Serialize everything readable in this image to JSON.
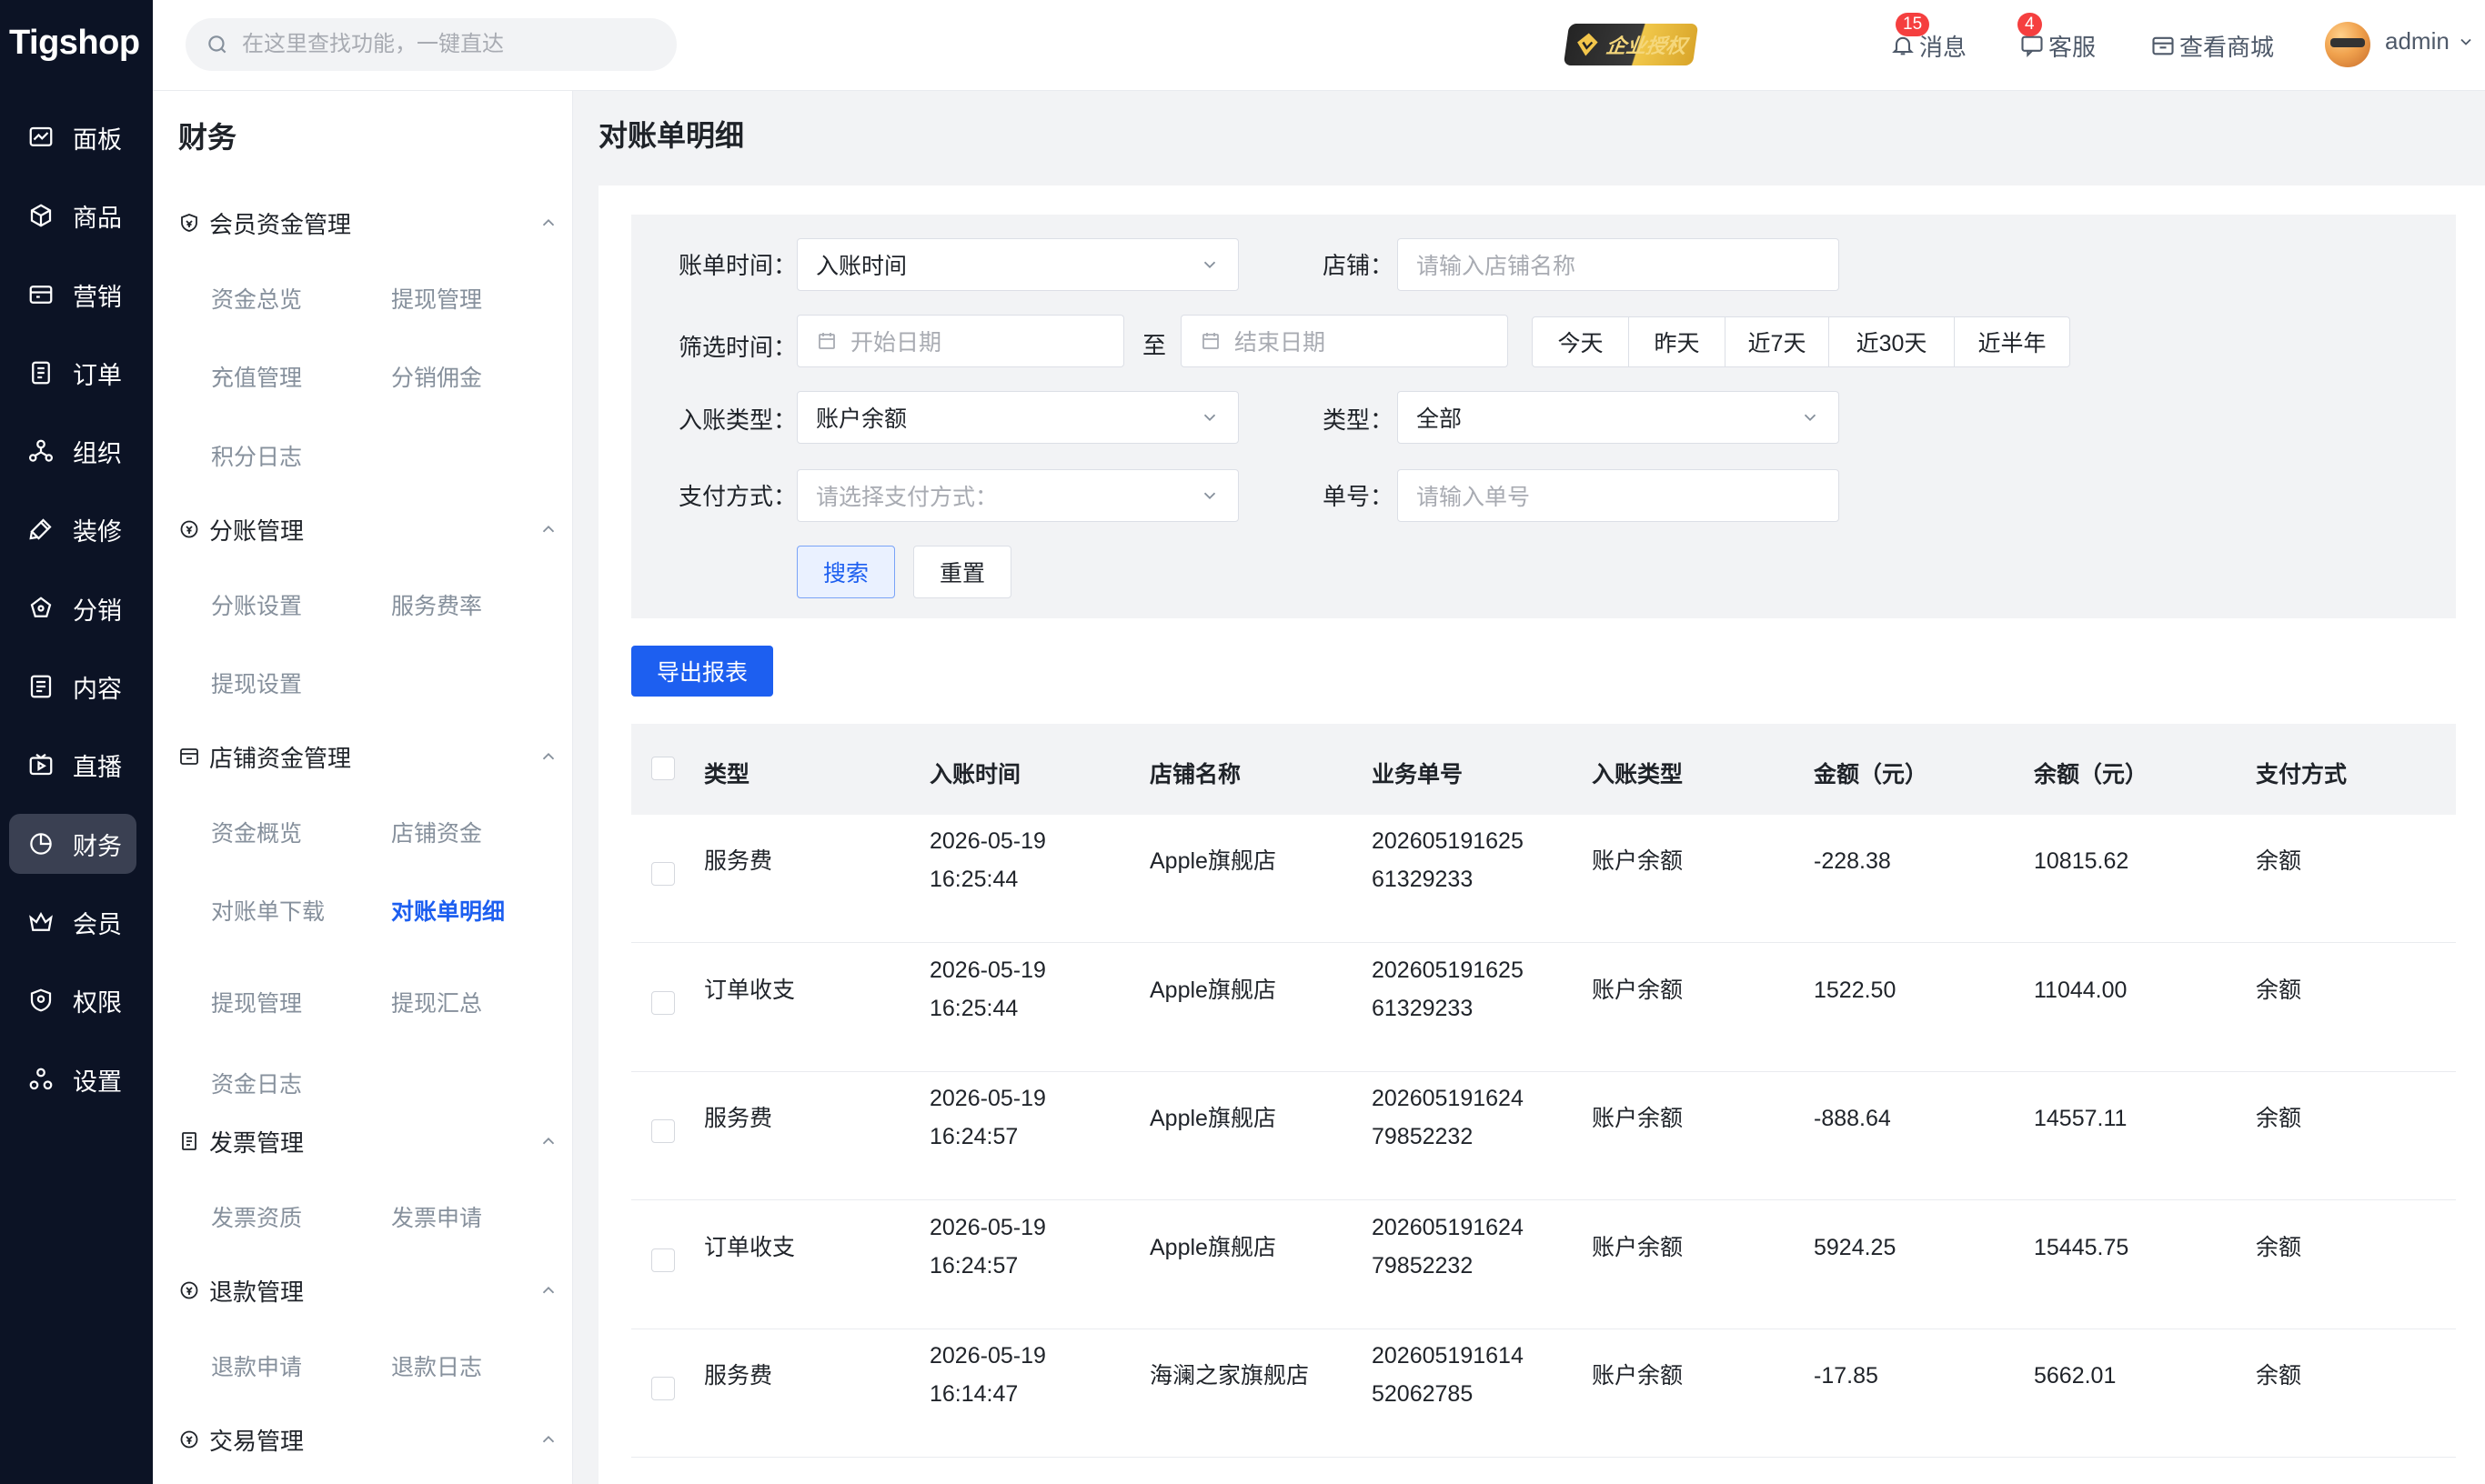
{
  "brand": {
    "logo_text": "Tigshop"
  },
  "rail": {
    "items": [
      {
        "label": "面板",
        "icon": "dashboard-icon"
      },
      {
        "label": "商品",
        "icon": "cube-icon"
      },
      {
        "label": "营销",
        "icon": "marketing-icon"
      },
      {
        "label": "订单",
        "icon": "order-icon"
      },
      {
        "label": "组织",
        "icon": "org-icon"
      },
      {
        "label": "装修",
        "icon": "paint-icon"
      },
      {
        "label": "分销",
        "icon": "share-icon"
      },
      {
        "label": "内容",
        "icon": "content-icon"
      },
      {
        "label": "直播",
        "icon": "live-icon"
      },
      {
        "label": "财务",
        "icon": "finance-icon",
        "active": true
      },
      {
        "label": "会员",
        "icon": "crown-icon"
      },
      {
        "label": "权限",
        "icon": "shield-icon"
      },
      {
        "label": "设置",
        "icon": "settings-icon"
      }
    ]
  },
  "header": {
    "search_placeholder": "在这里查找功能，一键直达",
    "enterprise_badge": "企业授权",
    "messages_label": "消息",
    "messages_count": "15",
    "service_label": "客服",
    "service_count": "4",
    "shop_label": "查看商城",
    "user_name": "admin"
  },
  "submenu": {
    "title": "财务",
    "groups": [
      {
        "label": "会员资金管理",
        "items": [
          "资金总览",
          "提现管理",
          "充值管理",
          "分销佣金",
          "积分日志"
        ]
      },
      {
        "label": "分账管理",
        "items": [
          "分账设置",
          "服务费率",
          "提现设置"
        ]
      },
      {
        "label": "店铺资金管理",
        "items": [
          "资金概览",
          "店铺资金",
          "对账单下载",
          "对账单明细",
          "提现管理",
          "提现汇总",
          "资金日志"
        ]
      },
      {
        "label": "发票管理",
        "items": [
          "发票资质",
          "发票申请"
        ]
      },
      {
        "label": "退款管理",
        "items": [
          "退款申请",
          "退款日志"
        ]
      },
      {
        "label": "交易管理",
        "items": []
      }
    ],
    "active_item": "对账单明细"
  },
  "page": {
    "title": "对账单明细",
    "filters": {
      "bill_time_label": "账单时间：",
      "bill_time_value": "入账时间",
      "shop_label": "店铺：",
      "shop_placeholder": "请输入店铺名称",
      "filter_time_label": "筛选时间：",
      "start_placeholder": "开始日期",
      "range_sep": "至",
      "end_placeholder": "结束日期",
      "quick_ranges": [
        "今天",
        "昨天",
        "近7天",
        "近30天",
        "近半年"
      ],
      "entry_type_label": "入账类型：",
      "entry_type_value": "账户余额",
      "type_label": "类型：",
      "type_value": "全部",
      "pay_method_label": "支付方式：",
      "pay_method_placeholder": "请选择支付方式：",
      "order_no_label": "单号：",
      "order_no_placeholder": "请输入单号",
      "search_button": "搜索",
      "reset_button": "重置"
    },
    "export_button": "导出报表",
    "table": {
      "columns": [
        "类型",
        "入账时间",
        "店铺名称",
        "业务单号",
        "入账类型",
        "金额（元）",
        "余额（元）",
        "支付方式"
      ],
      "rows": [
        {
          "type": "服务费",
          "date": "2026-05-19",
          "time": "16:25:44",
          "shop": "Apple旗舰店",
          "no1": "202605191625",
          "no2": "61329233",
          "entry": "账户余额",
          "amount": "-228.38",
          "balance": "10815.62",
          "pay": "余额"
        },
        {
          "type": "订单收支",
          "date": "2026-05-19",
          "time": "16:25:44",
          "shop": "Apple旗舰店",
          "no1": "202605191625",
          "no2": "61329233",
          "entry": "账户余额",
          "amount": "1522.50",
          "balance": "11044.00",
          "pay": "余额"
        },
        {
          "type": "服务费",
          "date": "2026-05-19",
          "time": "16:24:57",
          "shop": "Apple旗舰店",
          "no1": "202605191624",
          "no2": "79852232",
          "entry": "账户余额",
          "amount": "-888.64",
          "balance": "14557.11",
          "pay": "余额"
        },
        {
          "type": "订单收支",
          "date": "2026-05-19",
          "time": "16:24:57",
          "shop": "Apple旗舰店",
          "no1": "202605191624",
          "no2": "79852232",
          "entry": "账户余额",
          "amount": "5924.25",
          "balance": "15445.75",
          "pay": "余额"
        },
        {
          "type": "服务费",
          "date": "2026-05-19",
          "time": "16:14:47",
          "shop": "海澜之家旗舰店",
          "no1": "202605191614",
          "no2": "52062785",
          "entry": "账户余额",
          "amount": "-17.85",
          "balance": "5662.01",
          "pay": "余额"
        }
      ]
    }
  },
  "colors": {
    "accent": "#1d5ff0",
    "rail_bg": "#0c1325",
    "badge_red": "#f53f3f"
  }
}
